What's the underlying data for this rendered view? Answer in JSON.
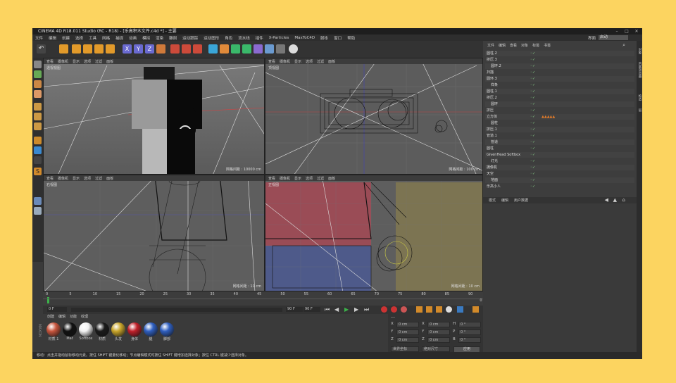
{
  "window": {
    "title": "CINEMA 4D R18.011 Studio (RC - R18) - [乐高积木文件.c4d *] - 主要"
  },
  "menu": [
    "文件",
    "编辑",
    "创建",
    "选择",
    "工具",
    "网格",
    "捕捉",
    "动画",
    "模拟",
    "渲染",
    "雕刻",
    "运动跟踪",
    "运动图形",
    "角色",
    "流水线",
    "插件",
    "X-Particles",
    "MaxToC4D",
    "脚本",
    "窗口",
    "帮助"
  ],
  "layout": {
    "label": "界面",
    "value": "启动"
  },
  "viewports": [
    {
      "name": "透视视图",
      "scale": "网格间距 : 10000 cm",
      "menu": [
        "查看",
        "摄像机",
        "显示",
        "选项",
        "过滤",
        "面板"
      ]
    },
    {
      "name": "顶视图",
      "scale": "网格间距 : 100 cm",
      "menu": [
        "查看",
        "摄像机",
        "显示",
        "选项",
        "过滤",
        "面板"
      ]
    },
    {
      "name": "右视图",
      "scale": "网格间距 : 10 cm",
      "menu": [
        "查看",
        "摄像机",
        "显示",
        "选项",
        "过滤",
        "面板"
      ]
    },
    {
      "name": "正视图",
      "scale": "网格间距 : 10 cm",
      "menu": [
        "查看",
        "摄像机",
        "显示",
        "选项",
        "过滤",
        "面板"
      ]
    }
  ],
  "timeline": {
    "ticks": [
      "0",
      "5",
      "10",
      "15",
      "20",
      "25",
      "30",
      "35",
      "40",
      "45",
      "50",
      "55",
      "60",
      "65",
      "70",
      "75",
      "80",
      "85",
      "90"
    ],
    "end_frame": "0 F",
    "current": "0 F",
    "start": "0 F",
    "max": "90 F",
    "max2": "90 F"
  },
  "materials": {
    "tabs": [
      "创建",
      "编辑",
      "功能",
      "纹理"
    ],
    "items": [
      {
        "label": "材质.1",
        "color": "#c8553d"
      },
      {
        "label": "Mat",
        "color": "#111111"
      },
      {
        "label": "Softbox",
        "color": "#f2f2f2"
      },
      {
        "label": "材质",
        "color": "#1a1a1a"
      },
      {
        "label": "头发",
        "color": "#c9a52a"
      },
      {
        "label": "身体",
        "color": "#c0202a"
      },
      {
        "label": "腿",
        "color": "#2f5fc0"
      },
      {
        "label": "脚部",
        "color": "#2f5fc0"
      }
    ]
  },
  "coords": {
    "header": "---",
    "rows": [
      {
        "axis": "X",
        "pos": "0 cm",
        "size": "0 cm",
        "rot_axis": "H",
        "rot": "0 °"
      },
      {
        "axis": "Y",
        "pos": "0 cm",
        "size": "0 cm",
        "rot_axis": "P",
        "rot": "0 °"
      },
      {
        "axis": "Z",
        "pos": "0 cm",
        "size": "0 cm",
        "rot_axis": "B",
        "rot": "0 °"
      }
    ],
    "mode": "世界坐标",
    "scale_mode": "绝对尺寸",
    "apply": "应用"
  },
  "object_manager": {
    "tabs": [
      "文件",
      "编辑",
      "查看",
      "对象",
      "标签",
      "书签"
    ],
    "objects": [
      "圆柱.2",
      "挤压.3",
      "圆环.2",
      "扫描",
      "圆环.3",
      "样条",
      "圆柱.1",
      "挤压.2",
      "圆环",
      "挤压",
      "立方体",
      "圆柱",
      "挤压.1",
      "管道.1",
      "管道",
      "圆柱",
      "GivenHead Softbox",
      "灯光",
      "摄像机",
      "天空",
      "地面",
      "乐高小人"
    ]
  },
  "attribute_manager": {
    "tabs": [
      "模式",
      "编辑",
      "用户数据"
    ]
  },
  "right_strip": [
    "对象",
    "内容浏览器",
    "构造",
    "层"
  ],
  "status": "移动：点击并拖动鼠标移动元素。按住 SHIFT 键量化移动；节点编辑模式时按住 SHIFT 键增加选择对象；按住 CTRL 键减少选择对象。"
}
